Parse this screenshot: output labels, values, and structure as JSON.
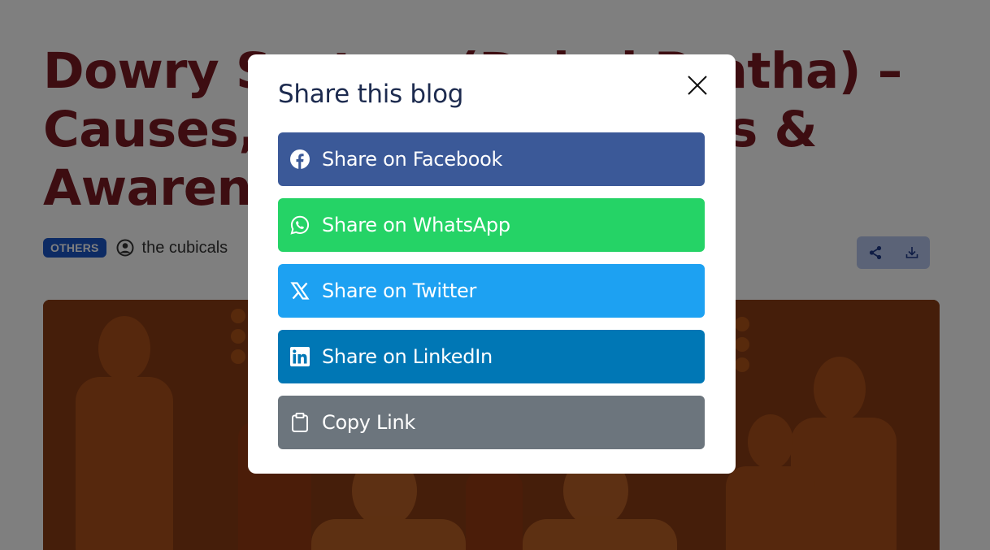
{
  "blog": {
    "title": "Dowry System (Dahej Pratha) – Causes, Effects, Solutions & Awareness",
    "category": "OTHERS",
    "author": "the cubicals"
  },
  "actions": {
    "share_icon": "share-icon",
    "download_icon": "download-icon"
  },
  "modal": {
    "title": "Share this blog",
    "close_icon": "close-icon",
    "buttons": [
      {
        "label": "Share on Facebook",
        "icon": "facebook-icon",
        "color": "#3b5998"
      },
      {
        "label": "Share on WhatsApp",
        "icon": "whatsapp-icon",
        "color": "#25d366"
      },
      {
        "label": "Share on Twitter",
        "icon": "x-twitter-icon",
        "color": "#1da1f2"
      },
      {
        "label": "Share on LinkedIn",
        "icon": "linkedin-icon",
        "color": "#0077b5"
      },
      {
        "label": "Copy Link",
        "icon": "clipboard-icon",
        "color": "#6c757d"
      }
    ]
  },
  "colors": {
    "title": "#7b1b22",
    "badge": "#1a56c8",
    "overlay": "rgba(0,0,0,0.5)"
  }
}
